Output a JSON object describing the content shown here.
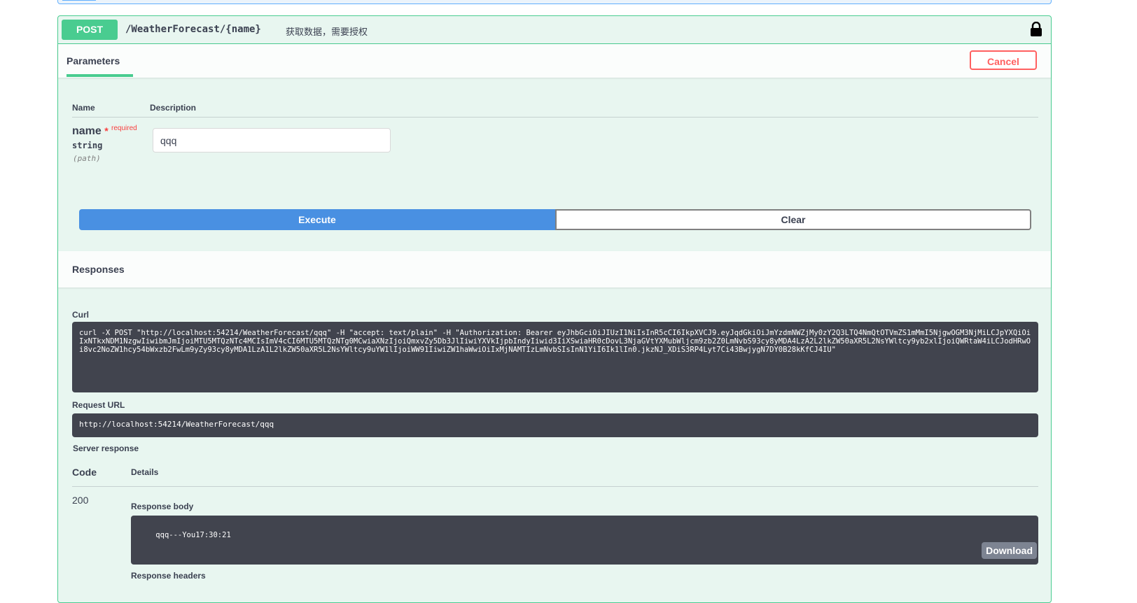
{
  "operation": {
    "method": "POST",
    "path": "/WeatherForecast/{name}",
    "summary": "获取数据，需要授权",
    "lock_icon": "lock-icon"
  },
  "parameters": {
    "tab_label": "Parameters",
    "cancel_label": "Cancel",
    "col_name": "Name",
    "col_description": "Description",
    "items": [
      {
        "name": "name",
        "required_star": "*",
        "required_label": "required",
        "type": "string",
        "in": "(path)",
        "value": "qqq"
      }
    ]
  },
  "actions": {
    "execute_label": "Execute",
    "clear_label": "Clear"
  },
  "responses": {
    "title": "Responses",
    "curl_label": "Curl",
    "curl_command": "curl -X POST \"http://localhost:54214/WeatherForecast/qqq\" -H \"accept: text/plain\" -H \"Authorization: Bearer eyJhbGciOiJIUzI1NiIsInR5cCI6IkpXVCJ9.eyJqdGkiOiJmYzdmNWZjMy0zY2Q3LTQ4NmQtOTVmZS1mMmI5NjgwOGM3NjMiLCJpYXQiOiIxNTkxNDM1NzgwIiwibmJmIjoiMTU5MTQzNTc4MCIsImV4cCI6MTU5MTQzNTg0MCwiaXNzIjoiQmxvZy5Db3JlIiwiYXVkIjpbIndyIiwid3IiXSwiaHR0cDovL3NjaGVtYXMubWljcm9zb2Z0LmNvbS93cy8yMDA4LzA2L2lkZW50aXR5L2NsYWltcy9yb2xlIjoiQWRtaW4iLCJodHRwOi8vc2NoZW1hcy54bWxzb2FwLm9yZy93cy8yMDA1LzA1L2lkZW50aXR5L2NsYWltcy9uYW1lIjoiWW91IiwiZW1haWwiOiIxMjNAMTIzLmNvbSIsInN1YiI6Ik1lIn0.jkzNJ_XDiS3RP4Lyt7Ci43BwjygN7DY0B28kKfCJ4IU\"",
    "request_url_label": "Request URL",
    "request_url": "http://localhost:54214/WeatherForecast/qqq",
    "server_response_label": "Server response",
    "code_col": "Code",
    "details_col": "Details",
    "code": "200",
    "response_body_label": "Response body",
    "response_body": "qqq---You17:30:21",
    "download_label": "Download",
    "response_headers_label": "Response headers"
  }
}
